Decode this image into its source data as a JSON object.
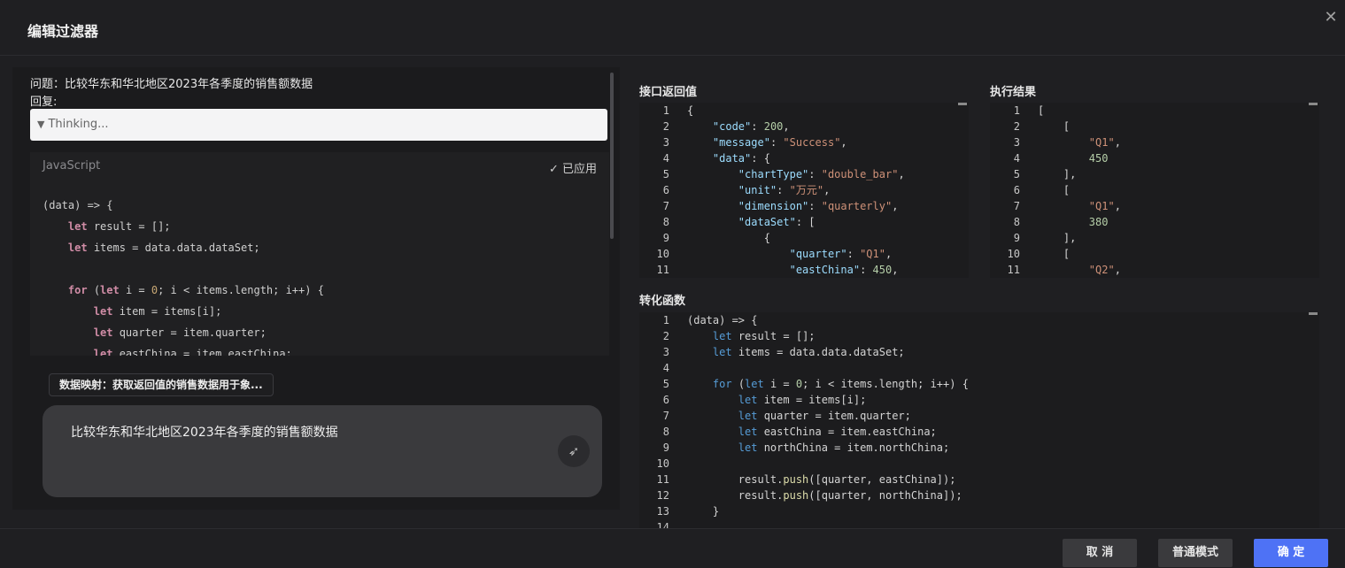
{
  "dialog": {
    "title": "编辑过滤器"
  },
  "left": {
    "question_line": "问题：比较华东和华北地区2023年各季度的销售额数据",
    "reply_label": "回复:",
    "thinking": "Thinking...",
    "code_lang": "JavaScript",
    "applied_label": "已应用",
    "mapping_chip": "数据映射：获取返回值的销售数据用于象...",
    "input_text": "比较华东和华北地区2023年各季度的销售额数据"
  },
  "labels": {
    "api_return": "接口返回值",
    "exec_result": "执行结果",
    "transform_fn": "转化函数"
  },
  "api_lines": [
    "1",
    "2",
    "3",
    "4",
    "5",
    "6",
    "7",
    "8",
    "9",
    "10",
    "11"
  ],
  "result_lines": [
    "1",
    "2",
    "3",
    "4",
    "5",
    "6",
    "7",
    "8",
    "9",
    "10",
    "11"
  ],
  "transform_lines": [
    "1",
    "2",
    "3",
    "4",
    "5",
    "6",
    "7",
    "8",
    "9",
    "10",
    "11",
    "12",
    "13",
    "14"
  ],
  "footer": {
    "cancel": "取 消",
    "normal_mode": "普通模式",
    "confirm": "确 定"
  },
  "colors": {
    "accent": "#4e72f5",
    "background": "#1f1f22"
  },
  "icons": {
    "close": "close-icon",
    "applied": "check-icon",
    "send": "send-icon",
    "thinking_toggle": "caret-down-icon"
  }
}
